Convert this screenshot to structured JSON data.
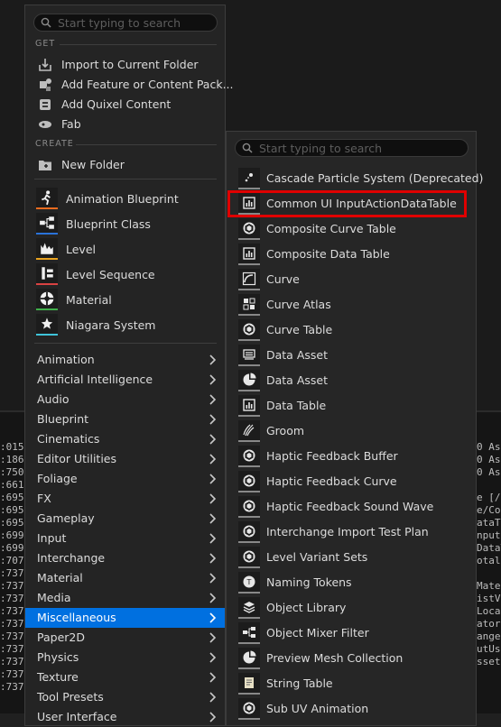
{
  "search": {
    "placeholder": "Start typing to search"
  },
  "log": {
    "left": [
      ":015",
      ":186",
      ":750",
      ":661",
      ":695",
      ":695",
      ":695",
      ":699",
      ":699",
      ":707",
      ":737",
      ":737",
      ":737",
      ":737",
      ":737",
      ":737",
      ":737",
      ":737",
      ":737",
      ":737"
    ],
    "right": [
      "0 Asy",
      "0 Asy",
      "0 Asy",
      "",
      "e [/C",
      "e/Con",
      "ataTab",
      "nput/",
      "DataT",
      "otal",
      "",
      "Mate",
      "istV",
      "Local",
      "ator",
      "angel",
      "utUs",
      "sset"
    ]
  },
  "main_menu": {
    "section_get": "GET",
    "get_items": [
      {
        "label": "Import to Current Folder",
        "icon": "import-icon"
      },
      {
        "label": "Add Feature or Content Pack...",
        "icon": "feature-pack-icon"
      },
      {
        "label": "Add Quixel Content",
        "icon": "quixel-icon"
      },
      {
        "label": "Fab",
        "icon": "fab-icon"
      }
    ],
    "section_create": "CREATE",
    "new_folder": "New Folder",
    "basic_assets": [
      {
        "label": "Animation Blueprint",
        "color": "#e86b1f",
        "icon": "animation-blueprint-icon"
      },
      {
        "label": "Blueprint Class",
        "color": "#2a73d9",
        "icon": "blueprint-class-icon"
      },
      {
        "label": "Level",
        "color": "#e8a21f",
        "icon": "level-icon"
      },
      {
        "label": "Level Sequence",
        "color": "#d94242",
        "icon": "level-sequence-icon"
      },
      {
        "label": "Material",
        "color": "#3fae4a",
        "icon": "material-icon"
      },
      {
        "label": "Niagara System",
        "color": "#3fc4d9",
        "icon": "niagara-icon"
      }
    ],
    "categories": [
      "Animation",
      "Artificial Intelligence",
      "Audio",
      "Blueprint",
      "Cinematics",
      "Editor Utilities",
      "Foliage",
      "FX",
      "Gameplay",
      "Input",
      "Interchange",
      "Material",
      "Media",
      "Miscellaneous",
      "Paper2D",
      "Physics",
      "Texture",
      "Tool Presets",
      "User Interface"
    ],
    "selected_category": "Miscellaneous"
  },
  "sub_menu": {
    "items": [
      {
        "label": "Cascade Particle System (Deprecated)",
        "icon": "particle-icon"
      },
      {
        "label": "Common UI InputActionDataTable",
        "icon": "data-table-icon"
      },
      {
        "label": "Composite Curve Table",
        "icon": "curve-table-icon"
      },
      {
        "label": "Composite Data Table",
        "icon": "data-table-icon"
      },
      {
        "label": "Curve",
        "icon": "curve-icon"
      },
      {
        "label": "Curve Atlas",
        "icon": "curve-atlas-icon"
      },
      {
        "label": "Curve Table",
        "icon": "curve-table-icon"
      },
      {
        "label": "Data Asset",
        "icon": "data-asset-icon"
      },
      {
        "label": "Data Asset",
        "icon": "pie-icon"
      },
      {
        "label": "Data Table",
        "icon": "data-table-icon"
      },
      {
        "label": "Groom",
        "icon": "groom-icon"
      },
      {
        "label": "Haptic Feedback Buffer",
        "icon": "haptic-icon"
      },
      {
        "label": "Haptic Feedback Curve",
        "icon": "haptic-icon"
      },
      {
        "label": "Haptic Feedback Sound Wave",
        "icon": "haptic-icon"
      },
      {
        "label": "Interchange Import Test Plan",
        "icon": "cube-icon"
      },
      {
        "label": "Level Variant Sets",
        "icon": "cube-icon"
      },
      {
        "label": "Naming Tokens",
        "icon": "naming-tokens-icon"
      },
      {
        "label": "Object Library",
        "icon": "object-library-icon"
      },
      {
        "label": "Object Mixer Filter",
        "icon": "object-mixer-icon"
      },
      {
        "label": "Preview Mesh Collection",
        "icon": "pie-icon"
      },
      {
        "label": "String Table",
        "icon": "string-table-icon"
      },
      {
        "label": "Sub UV Animation",
        "icon": "cube-icon"
      }
    ],
    "highlighted": "Common UI InputActionDataTable"
  }
}
